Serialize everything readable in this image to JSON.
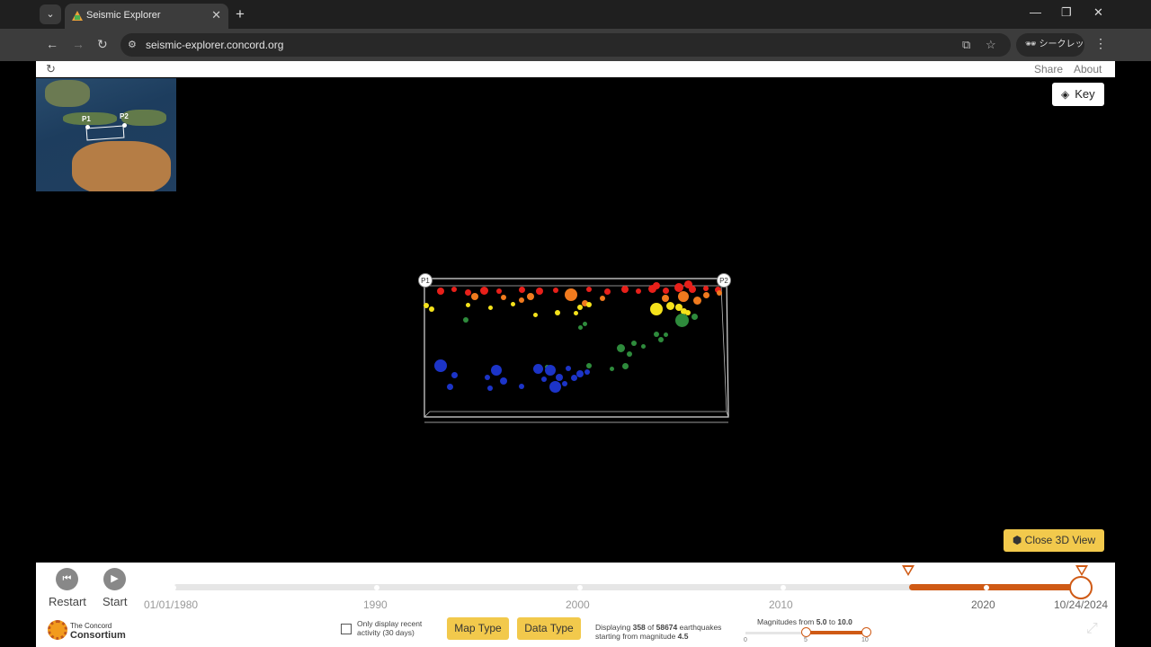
{
  "browser": {
    "tab_title": "Seismic Explorer",
    "url": "seismic-explorer.concord.org",
    "incognito_label": "シークレット"
  },
  "header": {
    "share_label": "Share",
    "about_label": "About"
  },
  "minimap": {
    "p1_label": "P1",
    "p2_label": "P2"
  },
  "key_button": "Key",
  "cross_section": {
    "p1": "P1",
    "p2": "P2"
  },
  "close_3d_label": "Close 3D View",
  "controls": {
    "restart_label": "Restart",
    "start_label": "Start"
  },
  "timeline": {
    "start_date": "01/01/1980",
    "years": [
      "1990",
      "2000",
      "2010",
      "2020"
    ],
    "end_date": "10/24/2024",
    "selection_start_fraction": 0.81,
    "selection_end_fraction": 1.0
  },
  "logo": {
    "line1": "The Concord",
    "line2": "Consortium"
  },
  "recent_activity": {
    "label": "Only display recent activity (30 days)",
    "checked": false
  },
  "map_type_label": "Map Type",
  "data_type_label": "Data Type",
  "display_info": {
    "prefix": "Displaying",
    "shown": "358",
    "of": "of",
    "total": "58674",
    "suffix": "earthquakes",
    "line2_prefix": "starting from magnitude",
    "min_magnitude": "4.5"
  },
  "magnitude_filter": {
    "label_prefix": "Magnitudes from",
    "from": "5.0",
    "to_word": "to",
    "to": "10.0",
    "scale_min": "0",
    "scale_mid": "5",
    "scale_max": "10"
  },
  "colors": {
    "accent": "#cf5a15",
    "button_yellow": "#f2c94c",
    "depth_shallow": "#e8201a",
    "depth_mid1": "#f07a1e",
    "depth_mid2": "#f4e21b",
    "depth_mid3": "#2e8b3c",
    "depth_deep": "#1c34c8"
  }
}
